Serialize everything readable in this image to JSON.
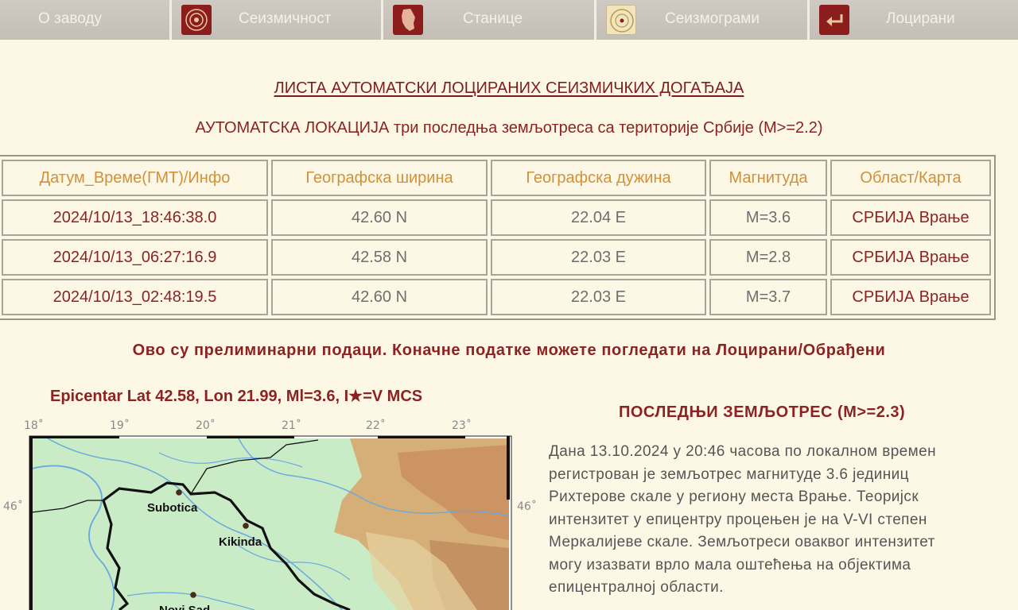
{
  "nav": {
    "items": [
      {
        "label": "О заводу",
        "icon": "none"
      },
      {
        "label": "Сеизмичност",
        "icon": "seismicity-icon"
      },
      {
        "label": "Станице",
        "icon": "serbia-map-icon"
      },
      {
        "label": "Сеизмограми",
        "icon": "seismogram-icon"
      },
      {
        "label": "Лоцирани",
        "icon": "return-arrow-icon"
      }
    ]
  },
  "title": "ЛИСТА АУТОМАТСКИ ЛОЦИРАНИХ СЕИЗМИЧКИХ ДОГАЂАЈА",
  "subtitle": "АУТОМАТСКА ЛОКАЦИЈА три последња земљотреса са територије Србије (M>=2.2)",
  "table": {
    "headers": [
      "Датум_Време(ГМТ)/Инфо",
      "Географска ширина",
      "Географска дужина",
      "Магнитуда",
      "Област/Карта"
    ],
    "rows": [
      [
        "2024/10/13_18:46:38.0",
        "42.60 N",
        "22.04 E",
        "M=3.6",
        "СРБИЈА Врање"
      ],
      [
        "2024/10/13_06:27:16.9",
        "42.58 N",
        "22.03 E",
        "M=2.8",
        "СРБИЈА Врање"
      ],
      [
        "2024/10/13_02:48:19.5",
        "42.60 N",
        "22.03 E",
        "M=3.7",
        "СРБИЈА Врање"
      ]
    ]
  },
  "notice": "Ово су прелиминарни подаци. Коначне податке можете погледати на Лоцирани/Обрађени",
  "map": {
    "caption": "Epicentar Lat 42.58, Lon 21.99, Ml=3.6, I★=V MCS",
    "lon_ticks": [
      "18˚",
      "19˚",
      "20˚",
      "21˚",
      "22˚",
      "23˚"
    ],
    "lat_ticks": [
      "46˚",
      "46˚"
    ],
    "cities": [
      "Subotica",
      "Kikinda",
      "Novi Sad"
    ],
    "colors": {
      "lowland": "#c9ecc6",
      "water": "#6aa9e0",
      "border": "#111111",
      "highland": "#d8a46a"
    }
  },
  "last_quake": {
    "title": "ПОСЛЕДЊИ ЗЕМЉОТРЕС (M>=2.3)",
    "text": "Дана 13.10.2024 у 20:46 часова по локалном времен\nрегистрован је земљотрес магнитуде 3.6 јединиц\nРихтерове скале у региону места Врање. Теоријск\nинтензитет у епицентру процењен је на V-VI степен\nМеркалијеве скале. Земљотреси оваквог интензитет\nмогу изазвати врло мала оштећења на објектима\nепицентралној области."
  }
}
